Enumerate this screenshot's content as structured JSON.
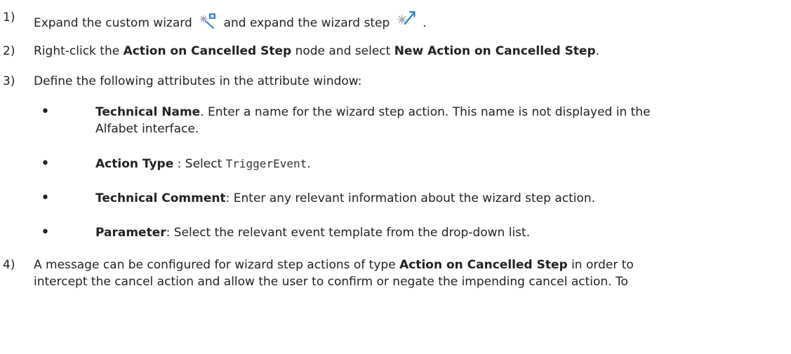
{
  "steps": [
    {
      "number": "1)",
      "text_a": "Expand the custom wizard",
      "icon_a": "custom-wizard-icon",
      "text_b": "and expand the wizard step",
      "icon_b": "wizard-step-icon",
      "text_c": "."
    },
    {
      "number": "2)",
      "text_a": "Right-click the ",
      "bold_a": "Action on Cancelled Step",
      "text_b": " node and select ",
      "bold_b": "New Action on Cancelled Step",
      "text_c": "."
    },
    {
      "number": "3)",
      "text": "Define the following attributes in the attribute window:"
    },
    {
      "number": "4)",
      "text_a": "A message can be configured for wizard step actions of type ",
      "bold_a": "Action on Cancelled Step",
      "text_b": " in order to",
      "line2": "intercept the cancel action and allow the user to confirm or negate the impending cancel action. To"
    }
  ],
  "bullets": [
    {
      "symbol": "•",
      "term": "Technical Name",
      "desc_line1": ". Enter a name for the wizard step action. This name is not displayed in the",
      "desc_line2": "Alfabet interface."
    },
    {
      "symbol": "•",
      "term": "Action Type",
      "desc_a": " : Select ",
      "code": "TriggerEvent",
      "desc_b": "."
    },
    {
      "symbol": "•",
      "term": "Technical Comment",
      "desc": ": Enter any relevant information about the wizard step action."
    },
    {
      "symbol": "•",
      "term": "Parameter",
      "desc": ": Select the relevant event template from the drop-down list."
    }
  ],
  "colors": {
    "text": "#222222",
    "icon_blue": "#2f7fd6",
    "icon_gray": "#9aa3ad"
  }
}
